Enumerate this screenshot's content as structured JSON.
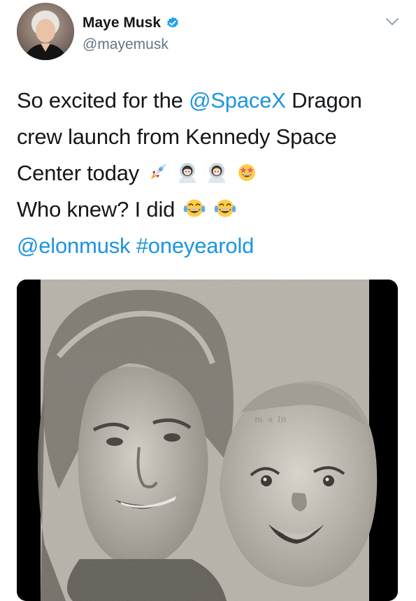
{
  "tweet": {
    "author": {
      "name": "Maye Musk",
      "handle": "@mayemusk",
      "verified": true
    },
    "body": {
      "line1_pre": "So excited for the ",
      "mention_spacex": "@SpaceX",
      "line1_post": " Dragon",
      "line2": "crew launch from Kennedy Space",
      "line3": "Center today",
      "line4": "Who knew? I did",
      "mention_elon": "@elonmusk",
      "hashtag": "#oneyearold"
    },
    "emojis": [
      "rocket-icon",
      "astronaut-icon",
      "astronaut-icon",
      "star-struck-icon",
      "tears-of-joy-icon",
      "tears-of-joy-icon"
    ],
    "media": {
      "type": "newspaper-photo"
    }
  },
  "colors": {
    "link": "#1b95e0",
    "verified": "#1da1f2",
    "secondary_text": "#657786",
    "text": "#14171a"
  }
}
